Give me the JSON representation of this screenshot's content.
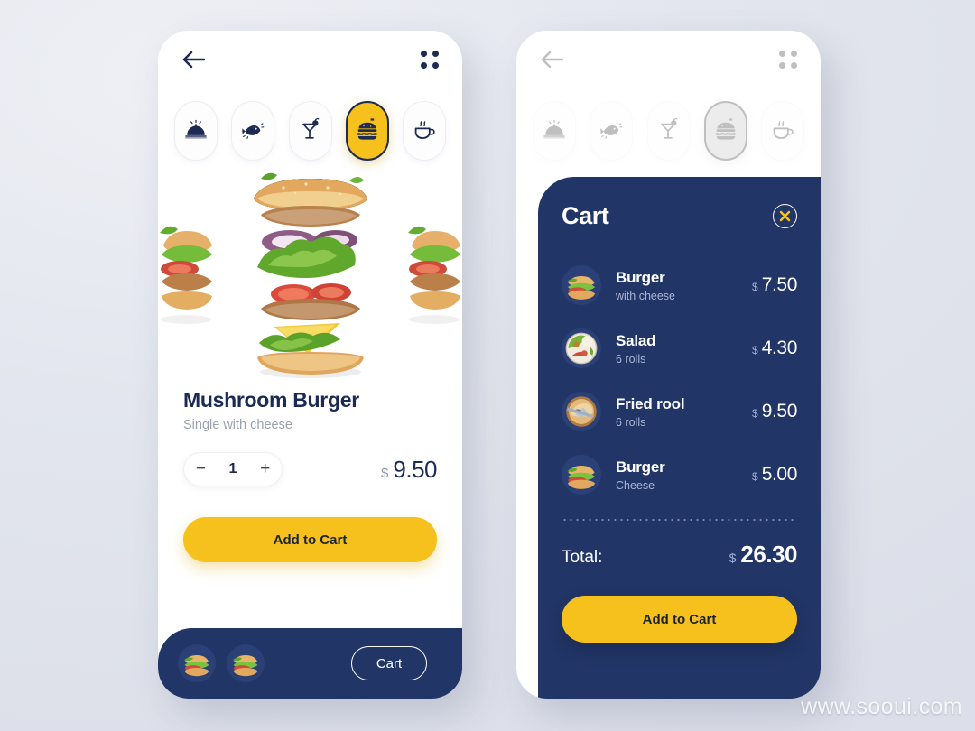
{
  "colors": {
    "navy": "#213566",
    "yellow": "#f6c01d",
    "bg": "#e3e6ee",
    "muted": "#9aa0ad"
  },
  "screens": {
    "detail": {
      "topbar": {
        "back_icon": "back-arrow-icon",
        "menu_icon": "grid-dots-icon"
      },
      "categories": [
        {
          "id": "dome",
          "icon": "food-dome-icon",
          "active": false
        },
        {
          "id": "fish",
          "icon": "fish-icon",
          "active": false
        },
        {
          "id": "drink",
          "icon": "cocktail-glass-icon",
          "active": false
        },
        {
          "id": "burger",
          "icon": "burger-icon",
          "active": true
        },
        {
          "id": "coffee",
          "icon": "coffee-cup-icon",
          "active": false
        }
      ],
      "product": {
        "image": "exploded-burger-photo",
        "title": "Mushroom Burger",
        "subtitle": "Single with cheese",
        "quantity": "1",
        "decrement_label": "−",
        "increment_label": "+",
        "currency": "$",
        "price": "9.50"
      },
      "add_to_cart_label": "Add to Cart",
      "bottom_bar": {
        "thumbs": [
          {
            "icon": "burger-thumb-icon"
          },
          {
            "icon": "burger-thumb-icon"
          }
        ],
        "cart_label": "Cart"
      }
    },
    "cart": {
      "title": "Cart",
      "close_icon": "close-x-icon",
      "items": [
        {
          "thumb": "burger-thumb-icon",
          "name": "Burger",
          "desc": "with cheese",
          "currency": "$",
          "price": "7.50"
        },
        {
          "thumb": "salad-thumb-icon",
          "name": "Salad",
          "desc": "6 rolls",
          "currency": "$",
          "price": "4.30"
        },
        {
          "thumb": "friedroll-thumb-icon",
          "name": "Fried rool",
          "desc": "6 rolls",
          "currency": "$",
          "price": "9.50"
        },
        {
          "thumb": "burger-thumb-icon",
          "name": "Burger",
          "desc": "Cheese",
          "currency": "$",
          "price": "5.00"
        }
      ],
      "total_label": "Total:",
      "total_currency": "$",
      "total": "26.30",
      "add_to_cart_label": "Add to Cart"
    }
  },
  "watermark": "www.sooui.com"
}
